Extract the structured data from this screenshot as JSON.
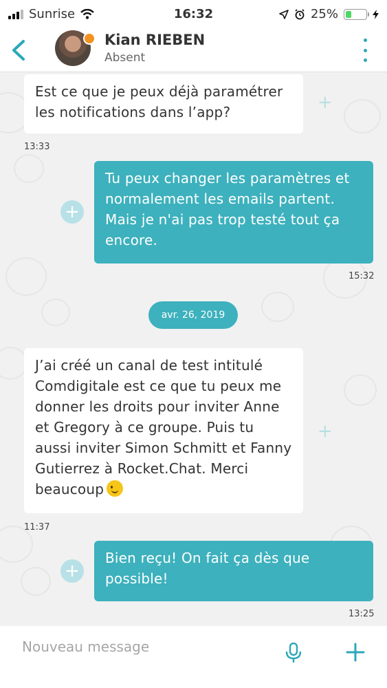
{
  "status_bar": {
    "carrier": "Sunrise",
    "time": "16:32",
    "battery_percent": "25%",
    "battery_level": 0.25
  },
  "header": {
    "name": "Kian RIEBEN",
    "status": "Absent"
  },
  "messages": [
    {
      "direction": "in",
      "text": "Est ce que je peux déjà paramétrer les notifications dans l’app?",
      "time": "13:33"
    },
    {
      "direction": "out",
      "text": "Tu peux changer les paramètres et normalement les emails partent. Mais je n'ai pas trop testé tout ça encore.",
      "time": "15:32"
    },
    {
      "direction": "in",
      "text": "J’ai créé un canal de test intitulé Comdigitale est ce que tu peux me donner les droits pour inviter Anne et Gregory à ce groupe. Puis tu aussi inviter Simon Schmitt et Fanny Gutierrez à Rocket.Chat. Merci beaucoup",
      "time": "11:37"
    },
    {
      "direction": "out",
      "text": "Bien reçu! On fait ça dès que possible!",
      "time": "13:25"
    }
  ],
  "date_separator": "avr. 26, 2019",
  "composer": {
    "placeholder": "Nouveau message"
  },
  "icons": {
    "back": "chevron-left-icon",
    "menu": "more-vertical-icon",
    "mic": "microphone-icon",
    "add": "plus-icon",
    "react": "add-reaction-icon"
  },
  "colors": {
    "accent": "#3db1bd",
    "presence": "#f39221",
    "background": "#f1f1f1"
  }
}
